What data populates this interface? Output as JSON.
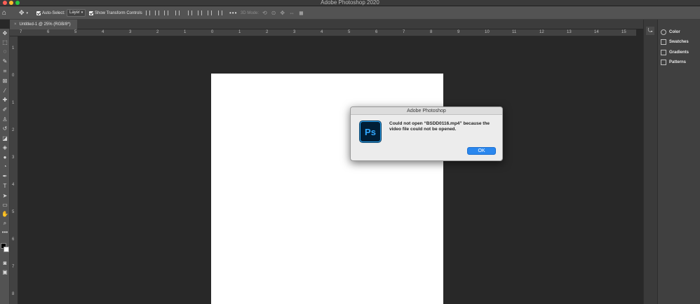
{
  "window": {
    "title": "Adobe Photoshop 2020",
    "colors": {
      "close": "#ff5f57",
      "minimize": "#febc2e",
      "zoom": "#28c840"
    }
  },
  "options_bar": {
    "auto_select_label": "Auto-Select:",
    "auto_select_value": "Layer",
    "show_transform_label": "Show Transform Controls",
    "mode_3d_label": "3D Mode:"
  },
  "document_tab": {
    "title": "Untitled-1 @ 25% (RGB/8*)"
  },
  "ruler": {
    "horizontal": [
      "7",
      "6",
      "5",
      "4",
      "3",
      "2",
      "1",
      "0",
      "1",
      "2",
      "3",
      "4",
      "5",
      "6",
      "7",
      "8",
      "9",
      "10",
      "11",
      "12",
      "13",
      "14",
      "15"
    ],
    "vertical": [
      "1",
      "0",
      "1",
      "2",
      "3",
      "4",
      "5",
      "6",
      "7",
      "8"
    ]
  },
  "panels": [
    {
      "label": "Color",
      "icon": "color-wheel-icon"
    },
    {
      "label": "Swatches",
      "icon": "swatches-grid-icon"
    },
    {
      "label": "Gradients",
      "icon": "gradient-icon"
    },
    {
      "label": "Patterns",
      "icon": "pattern-grid-icon"
    }
  ],
  "dialog": {
    "title": "Adobe Photoshop",
    "icon_text": "Ps",
    "message": "Could not open “BSDD0116.mp4” because the video file could not be opened.",
    "ok_label": "OK"
  },
  "tools": [
    "move-tool",
    "marquee-tool",
    "lasso-tool",
    "quick-select-tool",
    "crop-tool",
    "frame-tool",
    "eyedropper-tool",
    "healing-tool",
    "brush-tool",
    "stamp-tool",
    "history-brush-tool",
    "eraser-tool",
    "gradient-tool",
    "blur-tool",
    "dodge-tool",
    "pen-tool",
    "type-tool",
    "path-select-tool",
    "rectangle-tool",
    "hand-tool",
    "zoom-tool",
    "more-tools"
  ]
}
